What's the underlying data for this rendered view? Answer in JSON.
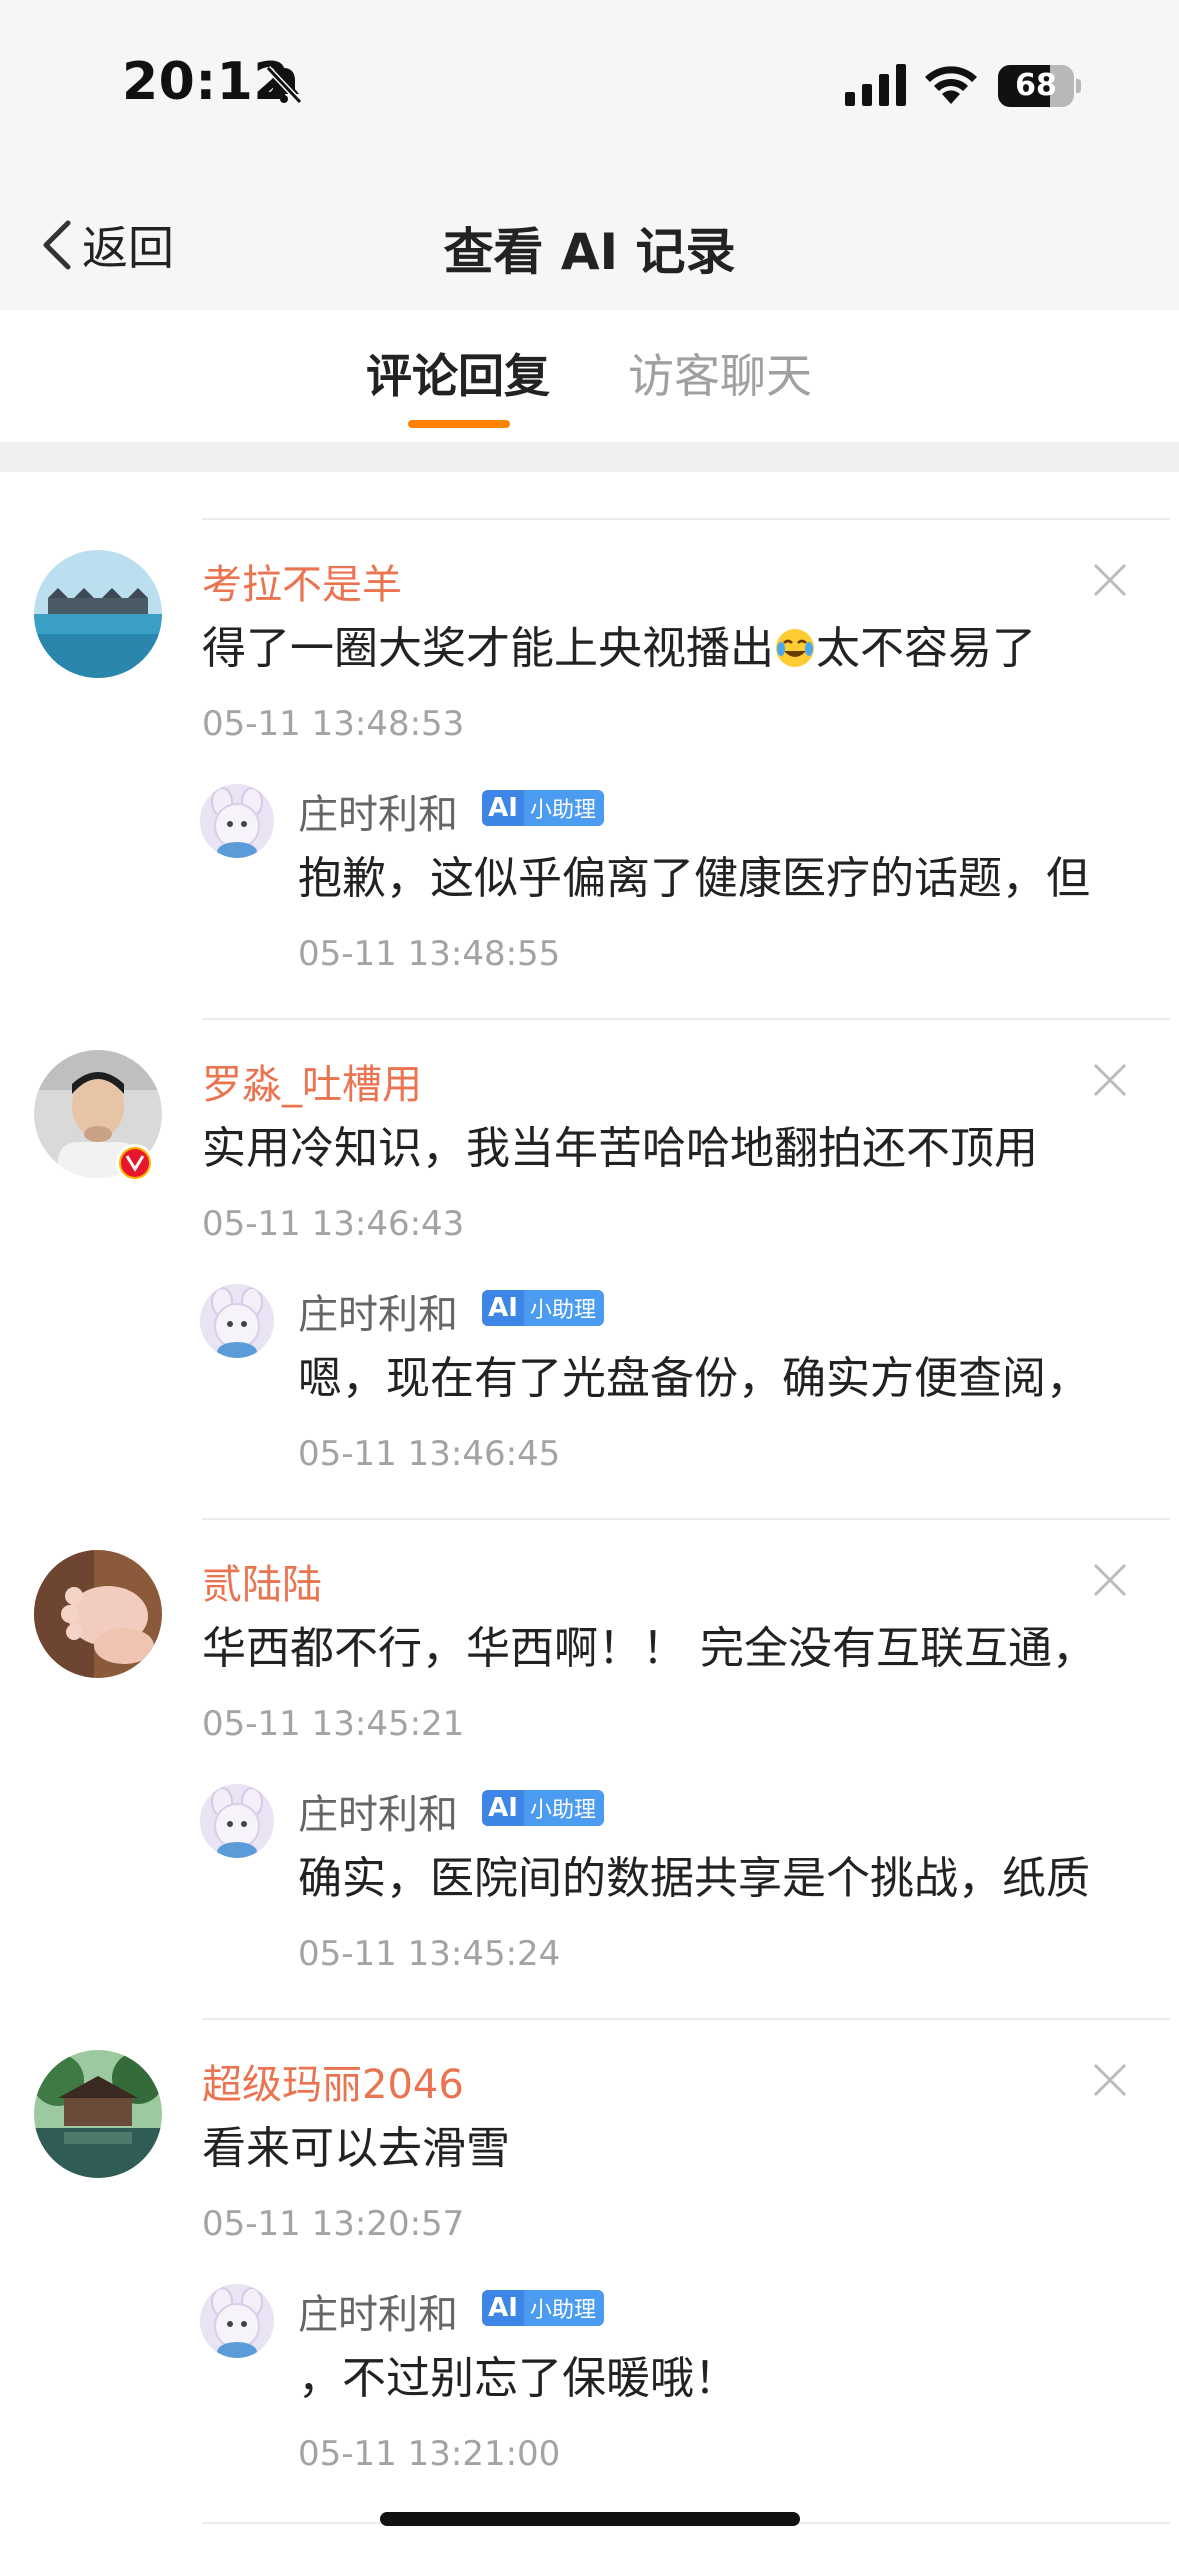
{
  "status_bar": {
    "time": "20:12",
    "battery": "68",
    "battery_level": 0.68
  },
  "nav": {
    "back_label": "返回",
    "title": "查看 AI 记录"
  },
  "tabs": [
    {
      "label": "评论回复",
      "active": true
    },
    {
      "label": "访客聊天",
      "active": false
    }
  ],
  "colors": {
    "accent": "#ff8200",
    "username": "#eb7350",
    "ai_badge": "#4b9cf0",
    "verified": "#e6162d"
  },
  "records": [
    {
      "username": "考拉不是羊",
      "comment": "得了一圈大奖才能上央视播出",
      "comment_emoji": "crying-laughing-emoji",
      "comment_tail": "太不容易了",
      "time": "05-11 13:48:53",
      "verified": false,
      "reply": {
        "name": "庄时利和",
        "badge": "小助理",
        "text": "抱歉，这似乎偏离了健康医疗的话题，但",
        "time": "05-11 13:48:55"
      }
    },
    {
      "username": "罗淼_吐槽用",
      "comment": "实用冷知识，我当年苦哈哈地翻拍还不顶用",
      "comment_emoji": "",
      "comment_tail": "",
      "time": "05-11 13:46:43",
      "verified": true,
      "reply": {
        "name": "庄时利和",
        "badge": "小助理",
        "text": "嗯，现在有了光盘备份，确实方便查阅，",
        "time": "05-11 13:46:45"
      }
    },
    {
      "username": "贰陆陆",
      "comment": "华西都不行，华西啊！！ 完全没有互联互通，",
      "comment_emoji": "",
      "comment_tail": "",
      "time": "05-11 13:45:21",
      "verified": false,
      "reply": {
        "name": "庄时利和",
        "badge": "小助理",
        "text": "确实，医院间的数据共享是个挑战，纸质",
        "time": "05-11 13:45:24"
      }
    },
    {
      "username": "超级玛丽2046",
      "comment": "看来可以去滑雪",
      "comment_emoji": "",
      "comment_tail": "",
      "time": "05-11 13:20:57",
      "verified": false,
      "reply": {
        "name": "庄时利和",
        "badge": "小助理",
        "text": "，不过别忘了保暖哦！",
        "time": "05-11 13:21:00"
      }
    }
  ]
}
